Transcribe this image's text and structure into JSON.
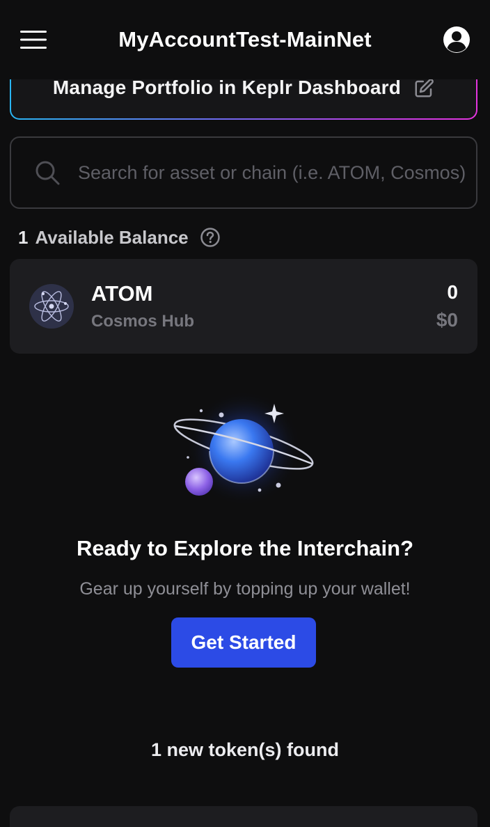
{
  "header": {
    "title": "MyAccountTest-MainNet",
    "menu_icon": "hamburger-menu-icon",
    "account_icon": "account-circle-icon"
  },
  "dashboard_banner": {
    "label": "Manage Portfolio in Keplr Dashboard",
    "icon": "edit-icon"
  },
  "search": {
    "placeholder": "Search for asset or chain (i.e. ATOM, Cosmos)",
    "value": "",
    "icon": "search-icon"
  },
  "balance": {
    "count": "1",
    "label": "Available Balance",
    "help_icon": "question-circle-icon"
  },
  "tokens": [
    {
      "symbol": "ATOM",
      "chain": "Cosmos Hub",
      "amount": "0",
      "fiat": "$0",
      "logo_icon": "cosmos-atom-icon"
    }
  ],
  "empty_state": {
    "illustration": "planet-illustration",
    "title": "Ready to Explore the Interchain?",
    "subtitle": "Gear up yourself by topping up your wallet!",
    "button_label": "Get Started"
  },
  "new_tokens": {
    "label": "1 new token(s) found"
  },
  "colors": {
    "background": "#0e0e0f",
    "card": "#1d1d20",
    "primary_button": "#2c4be6",
    "muted_text": "#77777e",
    "banner_gradient_start": "#29b5f3",
    "banner_gradient_end": "#e535e0"
  }
}
